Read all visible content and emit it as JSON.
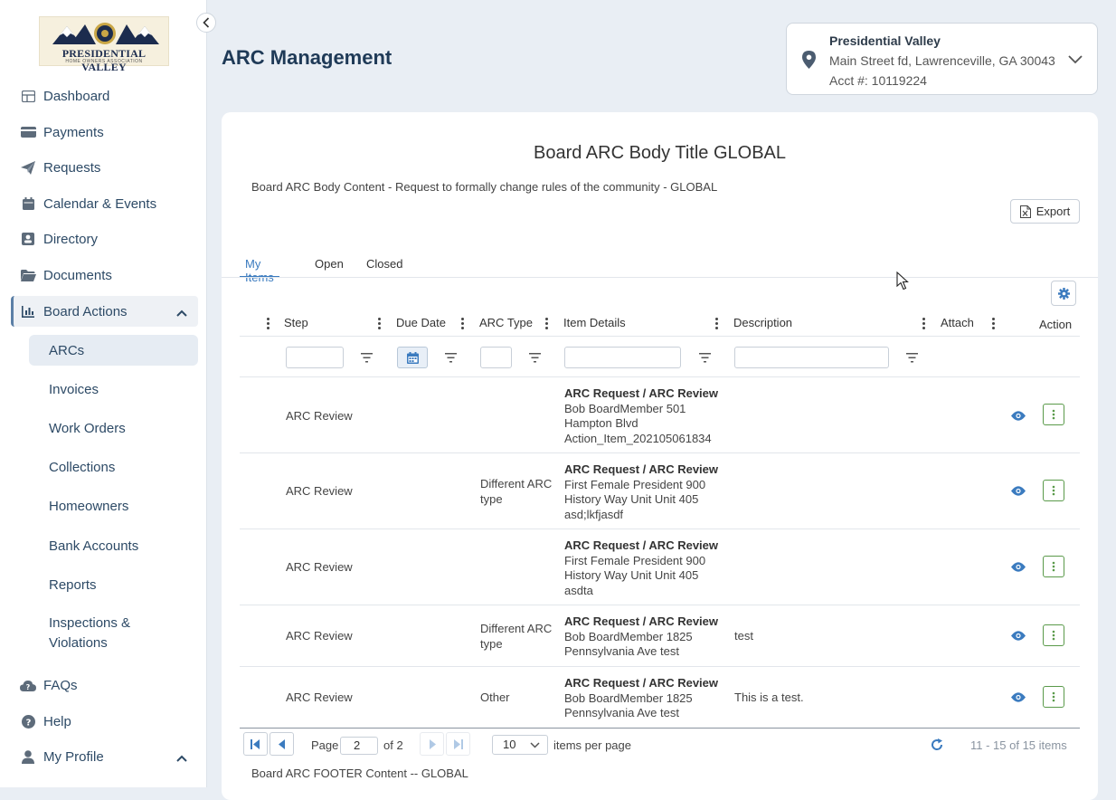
{
  "logo": {
    "line1": "PRESIDENTIAL VALLEY",
    "line2": "HOME OWNERS ASSOCIATION"
  },
  "sidebar": {
    "items": [
      {
        "label": "Dashboard",
        "icon": "dashboard-icon"
      },
      {
        "label": "Payments",
        "icon": "credit-card-icon"
      },
      {
        "label": "Requests",
        "icon": "paper-plane-icon"
      },
      {
        "label": "Calendar & Events",
        "icon": "calendar-icon"
      },
      {
        "label": "Directory",
        "icon": "contact-card-icon"
      },
      {
        "label": "Documents",
        "icon": "folder-icon"
      },
      {
        "label": "Board Actions",
        "icon": "chart-icon"
      }
    ],
    "board_sub": [
      "ARCs",
      "Invoices",
      "Work Orders",
      "Collections",
      "Homeowners",
      "Bank Accounts",
      "Reports",
      "Inspections &",
      "Violations"
    ],
    "bottom": [
      {
        "label": "FAQs",
        "icon": "cloud-question-icon"
      },
      {
        "label": "Help",
        "icon": "help-icon"
      },
      {
        "label": "My Profile",
        "icon": "user-icon"
      }
    ]
  },
  "header": {
    "title": "ARC Management"
  },
  "property": {
    "name": "Presidential Valley",
    "address": "Main Street fd, Lawrenceville, GA 30043",
    "account": "Acct #: 10119224"
  },
  "body": {
    "title": "Board ARC Body Title GLOBAL",
    "content": "Board ARC Body  Content  - Request to formally change rules of the community -  GLOBAL",
    "export_label": "Export",
    "footer": "Board ARC  FOOTER  Content  --  GLOBAL"
  },
  "tabs": [
    "My Items",
    "Open",
    "Closed"
  ],
  "columns": [
    "Step",
    "Due Date",
    "ARC Type",
    "Item Details",
    "Description",
    "Attach",
    "Action"
  ],
  "rows": [
    {
      "step": "ARC Review",
      "due": "",
      "type": [
        "",
        ""
      ],
      "title": "ARC Request / ARC Review",
      "details": [
        "Bob BoardMember 501",
        "Hampton Blvd",
        "Action_Item_202105061834"
      ],
      "description": ""
    },
    {
      "step": "ARC Review",
      "due": "",
      "type": [
        "Different ARC",
        "type"
      ],
      "title": "ARC Request / ARC Review",
      "details": [
        "First Female President 900",
        "History Way Unit Unit 405",
        "asd;lkfjasdf"
      ],
      "description": ""
    },
    {
      "step": "ARC Review",
      "due": "",
      "type": [
        "",
        ""
      ],
      "title": "ARC Request / ARC Review",
      "details": [
        "First Female President 900",
        "History Way Unit Unit 405",
        "asdta"
      ],
      "description": ""
    },
    {
      "step": "ARC Review",
      "due": "",
      "type": [
        "Different ARC",
        "type"
      ],
      "title": "ARC Request / ARC Review",
      "details": [
        "Bob BoardMember 1825",
        "Pennsylvania Ave test",
        ""
      ],
      "description": "test"
    },
    {
      "step": "ARC Review",
      "due": "",
      "type": [
        "Other",
        ""
      ],
      "title": "ARC Request / ARC Review",
      "details": [
        "Bob BoardMember 1825",
        "Pennsylvania Ave test",
        ""
      ],
      "description": "This is a test."
    }
  ],
  "pager": {
    "page_label": "Page",
    "current_page": "2",
    "of_label": "of 2",
    "per_page": "10",
    "per_page_label": "items per page",
    "summary": "11 - 15 of 15 items"
  },
  "colors": {
    "accent": "#3b7bbf",
    "nav_text": "#2d4a66",
    "action_green": "#5a9a4a",
    "background": "#e9eef4"
  }
}
